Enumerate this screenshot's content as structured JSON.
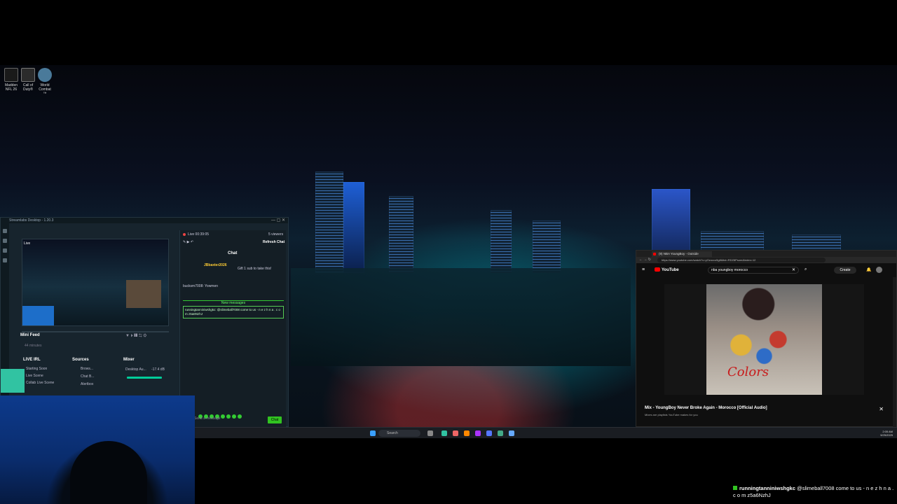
{
  "desktop": {
    "icons": [
      {
        "label": "Madden NFL 26",
        "color": "#1a1a1a"
      },
      {
        "label": "Call of Duty®",
        "color": "#2b2b2b"
      },
      {
        "label": "World Combat ™",
        "color": "#4a7a9a"
      }
    ]
  },
  "streamlabs": {
    "title": "Streamlabs Desktop - 1.20.3",
    "preview_label": "Live",
    "mini_feed": "Mini Feed",
    "mini_feed_sub": "44 minutes",
    "docks": {
      "scenes_header": "LIVE IRL",
      "scenes": [
        "Starting Soon",
        "Live Scene",
        "Collab Live Scene"
      ],
      "sources_header": "Sources",
      "sources": [
        "Brows...",
        "Chat B...",
        "Alertbox"
      ],
      "mixer_header": "Mixer",
      "mixer_item": "Desktop Au...",
      "mixer_db": "-17.4 dB"
    }
  },
  "chat": {
    "live_time": "Live 00:39:05",
    "viewers": "5 viewers",
    "refresh": "Refresh Chat",
    "title": "Chat",
    "donor": "JBbaxter2026",
    "donor_note": "Gift 1 sub to take this!",
    "msg1": "bucksm7008: Yowmen",
    "new_messages": "New messages",
    "highlight": "runningtanniniwshgkc: @slimeball7008 come to us - n e z h n a . c o m z5a6NzhJ",
    "input_placeholder": "Send a message",
    "send_label": "Chat"
  },
  "browser": {
    "tab_title": "(9) NBA YoungBoy - Outside",
    "url": "https://www.youtube.com/watch?v=yOzocco5g8&list=RDZ8Psom&index=12",
    "logo": "YouTube",
    "search_value": "nba youngboy morocco",
    "create_label": "Create",
    "album_text": "Colors",
    "mix_title": "Mix - YoungBoy Never Broke Again - Morocco [Official Audio]",
    "mix_sub": "Mixes are playlists YouTube makes for you"
  },
  "taskbar": {
    "search": "Search",
    "time": "2:05 AM",
    "date": "9/25/2025"
  },
  "overlay": {
    "user": "runningtanniniwshgkc",
    "message": "@slimeball7008 come to us - n e z h n a . c o m z5a6NzhJ"
  }
}
